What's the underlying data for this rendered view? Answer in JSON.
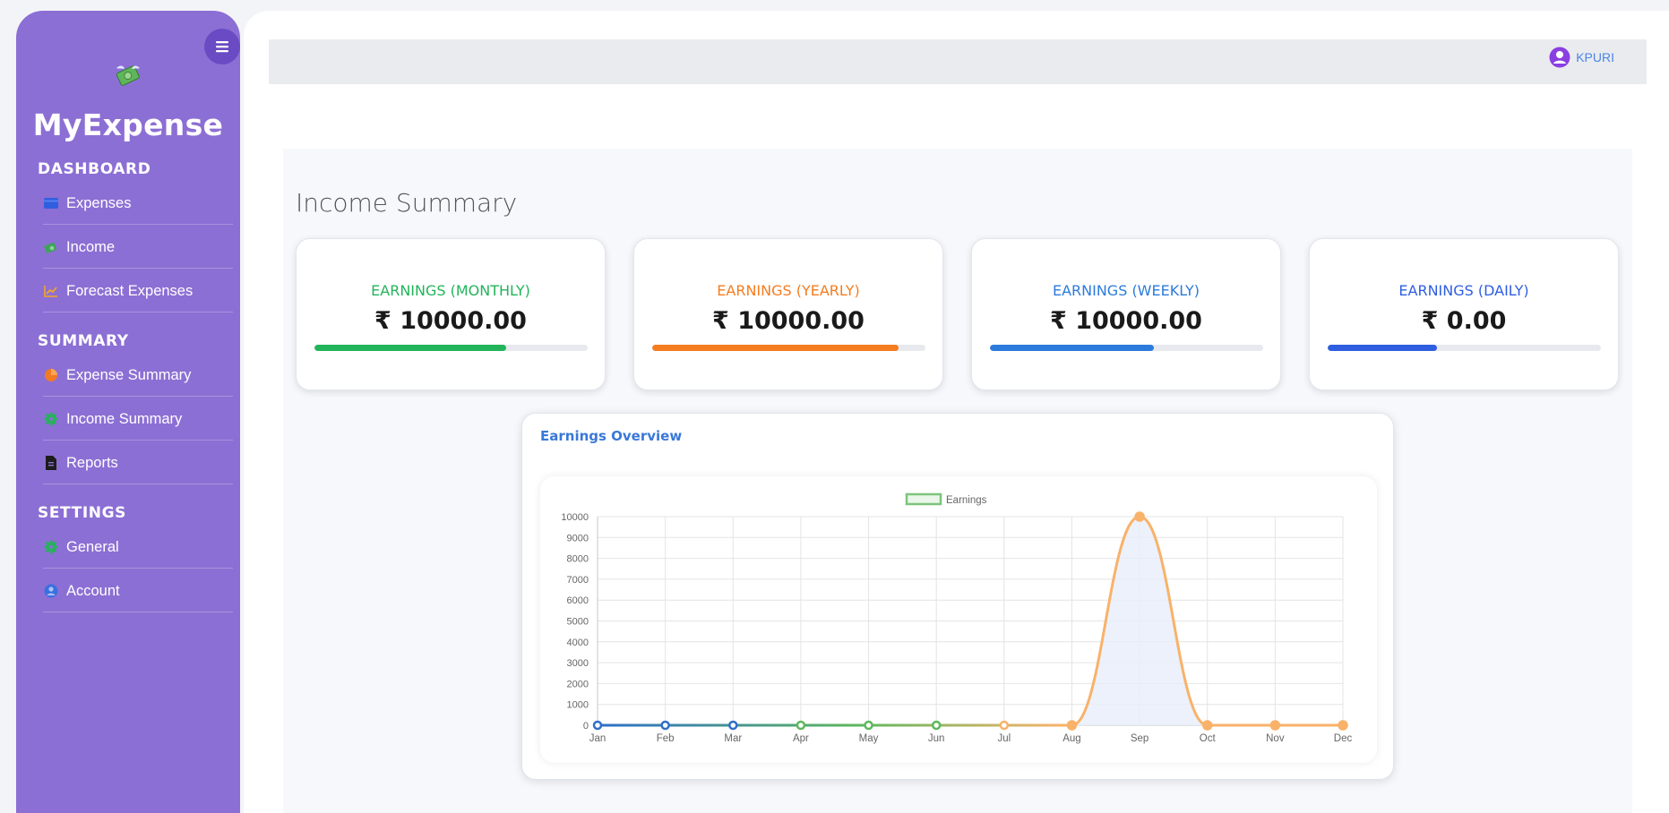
{
  "app": {
    "brand": "MyExpense"
  },
  "sidebar": {
    "sections": [
      {
        "title": "DASHBOARD",
        "items": [
          {
            "label": "Expenses",
            "icon": "wallet-icon",
            "color": "#2f5ee0"
          },
          {
            "label": "Income",
            "icon": "money-icon",
            "color": "#3fa35a"
          },
          {
            "label": "Forecast Expenses",
            "icon": "chart-line-icon",
            "color": "#f5a623"
          }
        ]
      },
      {
        "title": "SUMMARY",
        "items": [
          {
            "label": "Expense Summary",
            "icon": "pie-chart-icon",
            "color": "#f07b22"
          },
          {
            "label": "Income Summary",
            "icon": "gear-icon",
            "color": "#25b35a"
          },
          {
            "label": "Reports",
            "icon": "file-icon",
            "color": "#1d1d1d"
          }
        ]
      },
      {
        "title": "SETTINGS",
        "items": [
          {
            "label": "General",
            "icon": "gear-icon",
            "color": "#25b35a"
          },
          {
            "label": "Account",
            "icon": "user-circle-icon",
            "color": "#3a6fe0"
          }
        ]
      }
    ]
  },
  "header": {
    "user": "KPURI"
  },
  "main": {
    "title": "Income Summary",
    "cards": [
      {
        "label": "EARNINGS (MONTHLY)",
        "value": "₹ 10000.00",
        "color": "#22b45a",
        "progress": 0.7
      },
      {
        "label": "EARNINGS (YEARLY)",
        "value": "₹ 10000.00",
        "color": "#f57c1f",
        "progress": 0.9
      },
      {
        "label": "EARNINGS (WEEKLY)",
        "value": "₹ 10000.00",
        "color": "#2b7bdc",
        "progress": 0.6
      },
      {
        "label": "EARNINGS (DAILY)",
        "value": "₹ 0.00",
        "color": "#2f5ee0",
        "progress": 0.4
      }
    ],
    "chart_title": "Earnings Overview"
  },
  "chart_data": {
    "type": "line",
    "categories": [
      "Jan",
      "Feb",
      "Mar",
      "Apr",
      "May",
      "Jun",
      "Jul",
      "Aug",
      "Sep",
      "Oct",
      "Nov",
      "Dec"
    ],
    "series": [
      {
        "name": "Earnings",
        "values": [
          0,
          0,
          0,
          0,
          0,
          0,
          0,
          0,
          10000,
          0,
          0,
          0
        ]
      }
    ],
    "ylim": [
      0,
      10000
    ],
    "yticks": [
      0,
      1000,
      2000,
      3000,
      4000,
      5000,
      6000,
      7000,
      8000,
      9000,
      10000
    ],
    "grid": true,
    "legend": "top-center",
    "colors": {
      "start": "#2e6fc9",
      "mid": "#5cb85c",
      "end": "#f8b26a",
      "fill": "#e8edfa"
    }
  }
}
